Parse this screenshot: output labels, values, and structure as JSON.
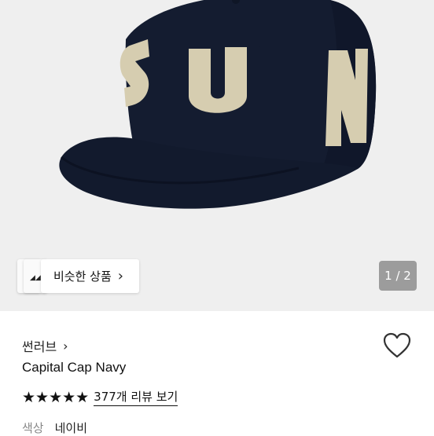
{
  "hero": {
    "image_alt": "navy cap with SUN lettering",
    "cap_text": "SUN",
    "cap_color": "#141c30",
    "letter_color": "#d6cdb0",
    "background": "#efefef"
  },
  "similar": {
    "label": "비슷한 상품",
    "chevron": "›"
  },
  "pager": {
    "text": "1 / 2"
  },
  "product": {
    "brand": "썬러브",
    "brand_chevron": "›",
    "name": "Capital Cap Navy",
    "stars": "★★★★★",
    "rating": 5,
    "review_link": "377개 리뷰 보기",
    "color_label": "색상",
    "color_value": "네이비"
  },
  "icons": {
    "wishlist": "heart-outline-icon",
    "similar_chevron": "chevron-right-icon",
    "brand_chevron": "chevron-right-icon"
  }
}
